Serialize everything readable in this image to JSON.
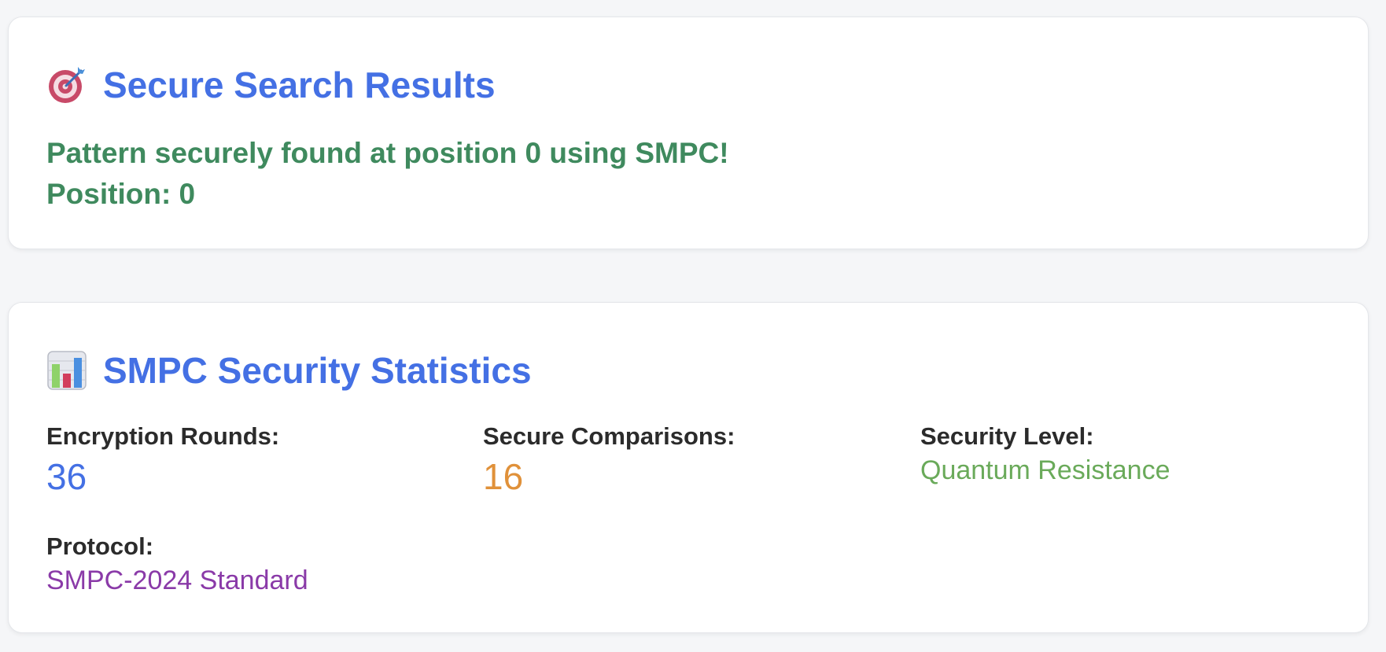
{
  "colors": {
    "accent": "#4470e4",
    "success": "#3f8a5e",
    "rounds": "#4470e4",
    "comparisons": "#e0913a",
    "security": "#6aaa5a",
    "protocol": "#8a3aa8"
  },
  "results": {
    "icon": "target-icon",
    "title": "Secure Search Results",
    "message": "Pattern securely found at position 0 using SMPC!",
    "position_label": "Position:",
    "position_value": "0"
  },
  "stats": {
    "icon": "bar-chart-icon",
    "title": "SMPC Security Statistics",
    "items": [
      {
        "label": "Encryption Rounds:",
        "value": "36"
      },
      {
        "label": "Secure Comparisons:",
        "value": "16"
      },
      {
        "label": "Security Level:",
        "value": "Quantum Resistance"
      },
      {
        "label": "Protocol:",
        "value": "SMPC-2024 Standard"
      }
    ]
  }
}
